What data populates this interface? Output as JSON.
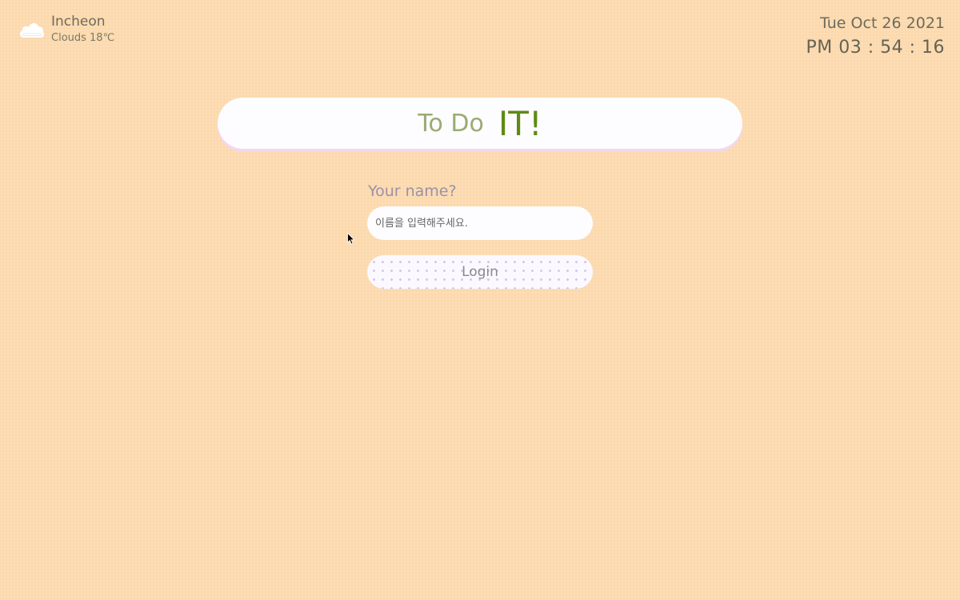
{
  "weather": {
    "icon": "cloud-icon",
    "city": "Incheon",
    "condition": "Clouds 18℃"
  },
  "clock": {
    "date": "Tue Oct 26 2021",
    "time": "PM 03 : 54 : 16"
  },
  "banner": {
    "title_part1": "To Do",
    "title_part2": "IT!"
  },
  "login": {
    "label": "Your name?",
    "placeholder": "이름을 입력해주세요.",
    "value": "",
    "button_label": "Login"
  },
  "colors": {
    "background": "#fcd9ad",
    "todo_text": "#9aab72",
    "it_text": "#5f8a14",
    "card": "#fdfcff"
  }
}
